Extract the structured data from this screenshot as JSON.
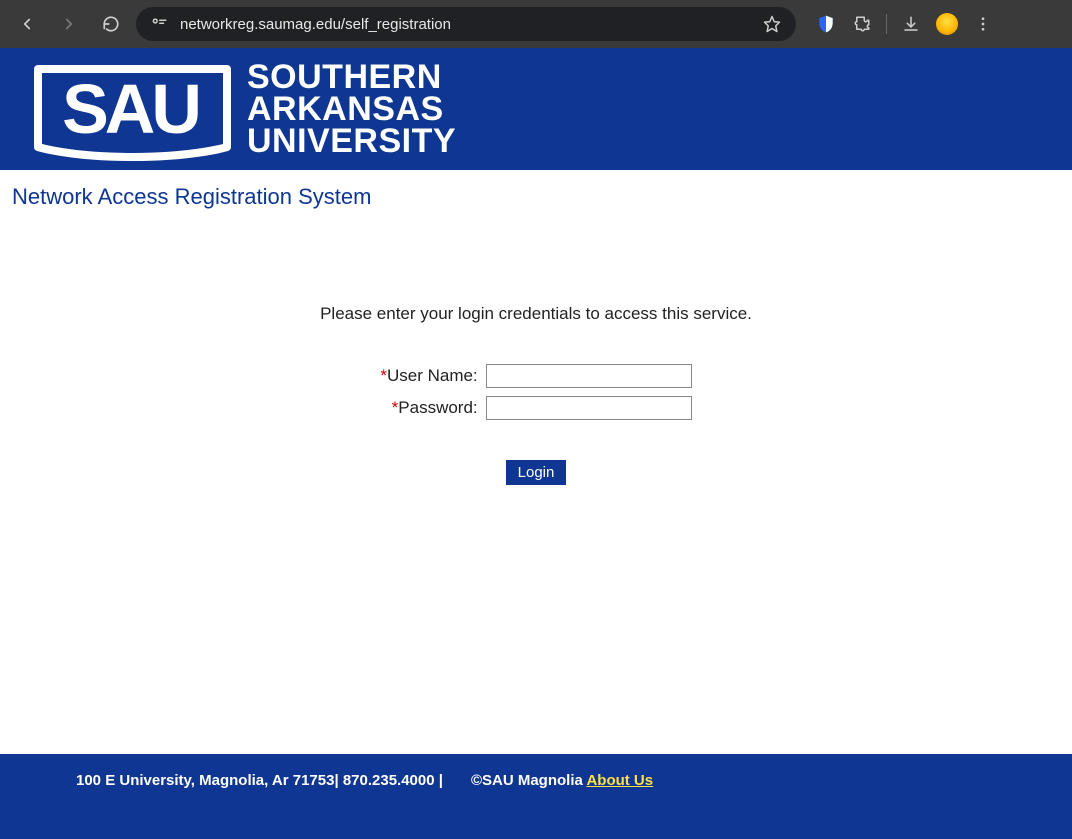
{
  "browser": {
    "url": "networkreg.saumag.edu/self_registration"
  },
  "header": {
    "logo_text_line1": "SOUTHERN",
    "logo_text_line2": "ARKANSAS",
    "logo_text_line3": "UNIVERSITY"
  },
  "page": {
    "title": "Network Access Registration System",
    "prompt": "Please enter your login credentials to access this service."
  },
  "form": {
    "required_marker": "*",
    "username_label": "User Name:",
    "username_value": "",
    "password_label": "Password:",
    "password_value": "",
    "login_button": "Login"
  },
  "footer": {
    "address": "100 E University, Magnolia, Ar 71753| 870.235.4000 |",
    "copyright": "©SAU Magnolia ",
    "about_link": "About Us"
  }
}
